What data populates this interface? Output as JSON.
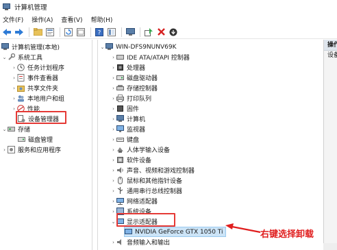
{
  "window": {
    "title": "计算机管理"
  },
  "menu": [
    "文件(F)",
    "操作(A)",
    "查看(V)",
    "帮助(H)"
  ],
  "toolbar": [
    "back-icon",
    "forward-icon",
    "folder-up-icon",
    "properties-icon",
    "refresh-icon",
    "export-icon",
    "help-icon",
    "view-icon",
    "monitor-icon",
    "scan-hardware-icon",
    "uninstall-icon",
    "update-driver-icon"
  ],
  "left_tree": {
    "root": "计算机管理(本地)",
    "system_tools": "系统工具",
    "task_scheduler": "任务计划程序",
    "event_viewer": "事件查看器",
    "shared_folders": "共享文件夹",
    "local_users": "本地用户和组",
    "performance": "性能",
    "device_manager": "设备管理器",
    "storage": "存储",
    "disk_management": "磁盘管理",
    "services_apps": "服务和应用程序"
  },
  "device_tree": {
    "computer": "WIN-DFS9NUNV69K",
    "categories": [
      "IDE ATA/ATAPI 控制器",
      "处理器",
      "磁盘驱动器",
      "存储控制器",
      "打印队列",
      "固件",
      "计算机",
      "监视器",
      "键盘",
      "人体学输入设备",
      "软件设备",
      "声音、视频和游戏控制器",
      "鼠标和其他指针设备",
      "通用串行总线控制器",
      "网络适配器",
      "系统设备",
      "显示适配器"
    ],
    "gpu": "NVIDIA GeForce GTX 1050 Ti",
    "last": "音频输入和输出"
  },
  "right_pane": {
    "header": "操作",
    "item": "设备"
  },
  "annotation": "右键选择卸载",
  "colors": {
    "highlight": "#e53935",
    "annotation": "#e01e1e",
    "selection": "#cce4f7"
  }
}
